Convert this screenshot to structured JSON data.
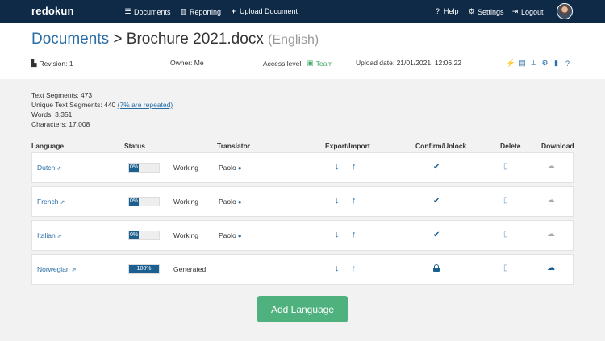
{
  "nav": {
    "brand": "redokun",
    "documents": "Documents",
    "reporting": "Reporting",
    "upload": "Upload Document",
    "help": "Help",
    "settings": "Settings",
    "logout": "Logout"
  },
  "header": {
    "crumb": "Documents",
    "separator": " > ",
    "filename": "Brochure 2021.docx",
    "source_language": "(English)",
    "revision": "Revision: 1",
    "owner": "Owner: Me",
    "access_label": "Access level:",
    "access_value": "Team",
    "upload_date": "Upload date: 21/01/2021, 12:06:22"
  },
  "stats": {
    "text_segments": "Text Segments: 473",
    "unique_segments": "Unique Text Segments: 440",
    "repeated_link": "(7% are repeated)",
    "words": "Words: 3,351",
    "characters": "Characters: 17,008"
  },
  "table": {
    "headers": {
      "language": "Language",
      "status": "Status",
      "translator": "Translator",
      "export_import": "Export/Import",
      "confirm_unlock": "Confirm/Unlock",
      "delete": "Delete",
      "download": "Download"
    },
    "rows": [
      {
        "language": "Dutch",
        "progress": "0%",
        "progress_value": 0,
        "status": "Working",
        "translator": "Paolo",
        "locked": false,
        "import_enabled": true,
        "download_ready": false
      },
      {
        "language": "French",
        "progress": "0%",
        "progress_value": 0,
        "status": "Working",
        "translator": "Paolo",
        "locked": false,
        "import_enabled": true,
        "download_ready": false
      },
      {
        "language": "Italian",
        "progress": "0%",
        "progress_value": 0,
        "status": "Working",
        "translator": "Paolo",
        "locked": false,
        "import_enabled": true,
        "download_ready": false
      },
      {
        "language": "Norwegian",
        "progress": "100%",
        "progress_value": 100,
        "status": "Generated",
        "translator": "",
        "locked": true,
        "import_enabled": false,
        "download_ready": true
      }
    ]
  },
  "add_language": "Add Language",
  "colors": {
    "navbar": "#0e2a47",
    "link": "#2a6ea6",
    "progress": "#1c5f91",
    "access_green": "#3aa860",
    "button_green": "#4fb27e"
  }
}
